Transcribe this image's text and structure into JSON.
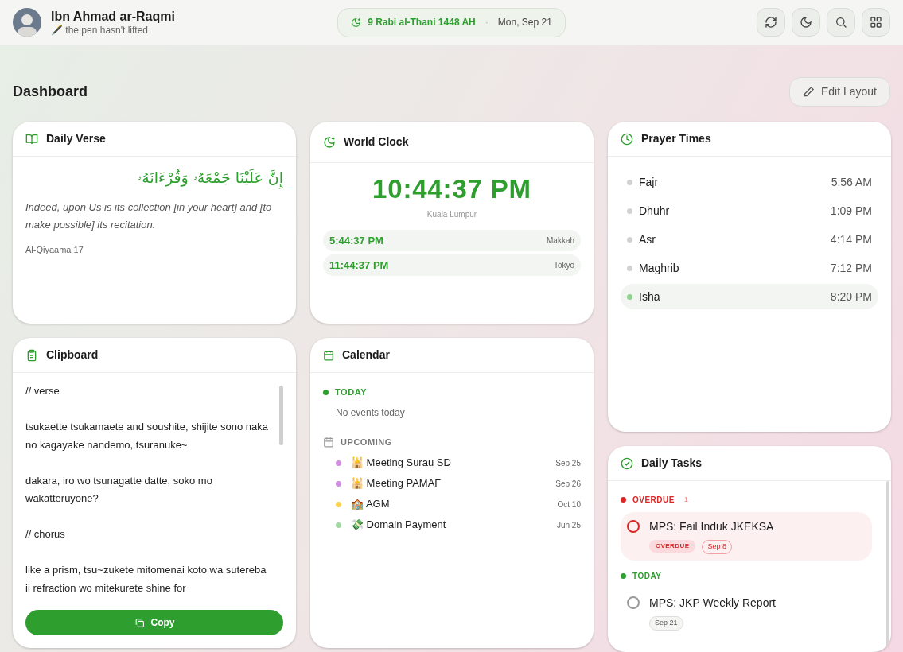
{
  "header": {
    "user_name": "Ibn Ahmad ar-Raqmi",
    "status": "🖋️ the pen hasn't lifted",
    "hijri_date": "9 Rabi al-Thani 1448 AH",
    "separator": "·",
    "date": "Mon, Sep 21",
    "actions": [
      {
        "kind": "refresh"
      },
      {
        "kind": "theme"
      },
      {
        "kind": "search"
      },
      {
        "kind": "apps"
      }
    ]
  },
  "page": {
    "title": "Dashboard",
    "edit_button": "Edit Layout"
  },
  "daily_verse": {
    "title": "Daily Verse",
    "arabic": "إِنَّ عَلَيْنَا جَمْعَهُۥ وَقُرْءَانَهُۥ",
    "translation": "Indeed, upon Us is its collection [in your heart] and [to make possible] its recitation.",
    "reference": "Al-Qiyaama 17"
  },
  "world_clock": {
    "title": "World Clock",
    "main_time": "10:44:37 PM",
    "main_city": "Kuala Lumpur",
    "others": [
      {
        "time": "5:44:37 PM",
        "city": "Makkah"
      },
      {
        "time": "11:44:37 PM",
        "city": "Tokyo"
      }
    ]
  },
  "prayer_times": {
    "title": "Prayer Times",
    "items": [
      {
        "name": "Fajr",
        "time": "5:56 AM",
        "selected": false
      },
      {
        "name": "Dhuhr",
        "time": "1:09 PM",
        "selected": false
      },
      {
        "name": "Asr",
        "time": "4:14 PM",
        "selected": false
      },
      {
        "name": "Maghrib",
        "time": "7:12 PM",
        "selected": false
      },
      {
        "name": "Isha",
        "time": "8:20 PM",
        "selected": true
      }
    ]
  },
  "clipboard": {
    "title": "Clipboard",
    "content": "// verse\n\ntsukaette tsukamaete and soushite, shijite sono naka no kagayake nandemo, tsuranuke~\n\ndakara, iro wo tsunagatte datte, soko mo wakatteruyone?\n\n// chorus\n\nlike a prism, tsu~zukete mitomenai koto wa sutereba ii refraction wo mitekurete shine for",
    "copy_button": "Copy"
  },
  "calendar": {
    "title": "Calendar",
    "today_label": "TODAY",
    "today_empty": "No events today",
    "upcoming_label": "UPCOMING",
    "events": [
      {
        "title": "🕌 Meeting Surau SD",
        "date": "Sep 25",
        "color": "#d08ee0"
      },
      {
        "title": "🕌 Meeting PAMAF",
        "date": "Sep 26",
        "color": "#d08ee0"
      },
      {
        "title": "🏫 AGM",
        "date": "Oct 10",
        "color": "#fcd34d"
      },
      {
        "title": "💸 Domain Payment",
        "date": "Jun 25",
        "color": "#a3d9a5"
      }
    ]
  },
  "daily_tasks": {
    "title": "Daily Tasks",
    "groups": [
      {
        "kind": "overdue",
        "label": "OVERDUE",
        "count": "1",
        "tasks": [
          {
            "title": "MPS: Fail Induk JKEKSA",
            "badge": "OVERDUE",
            "date": "Sep 8",
            "checked": false
          }
        ]
      },
      {
        "kind": "today",
        "label": "TODAY",
        "tasks": [
          {
            "title": "MPS: JKP Weekly Report",
            "date": "Sep 21",
            "checked": false
          }
        ]
      }
    ]
  }
}
